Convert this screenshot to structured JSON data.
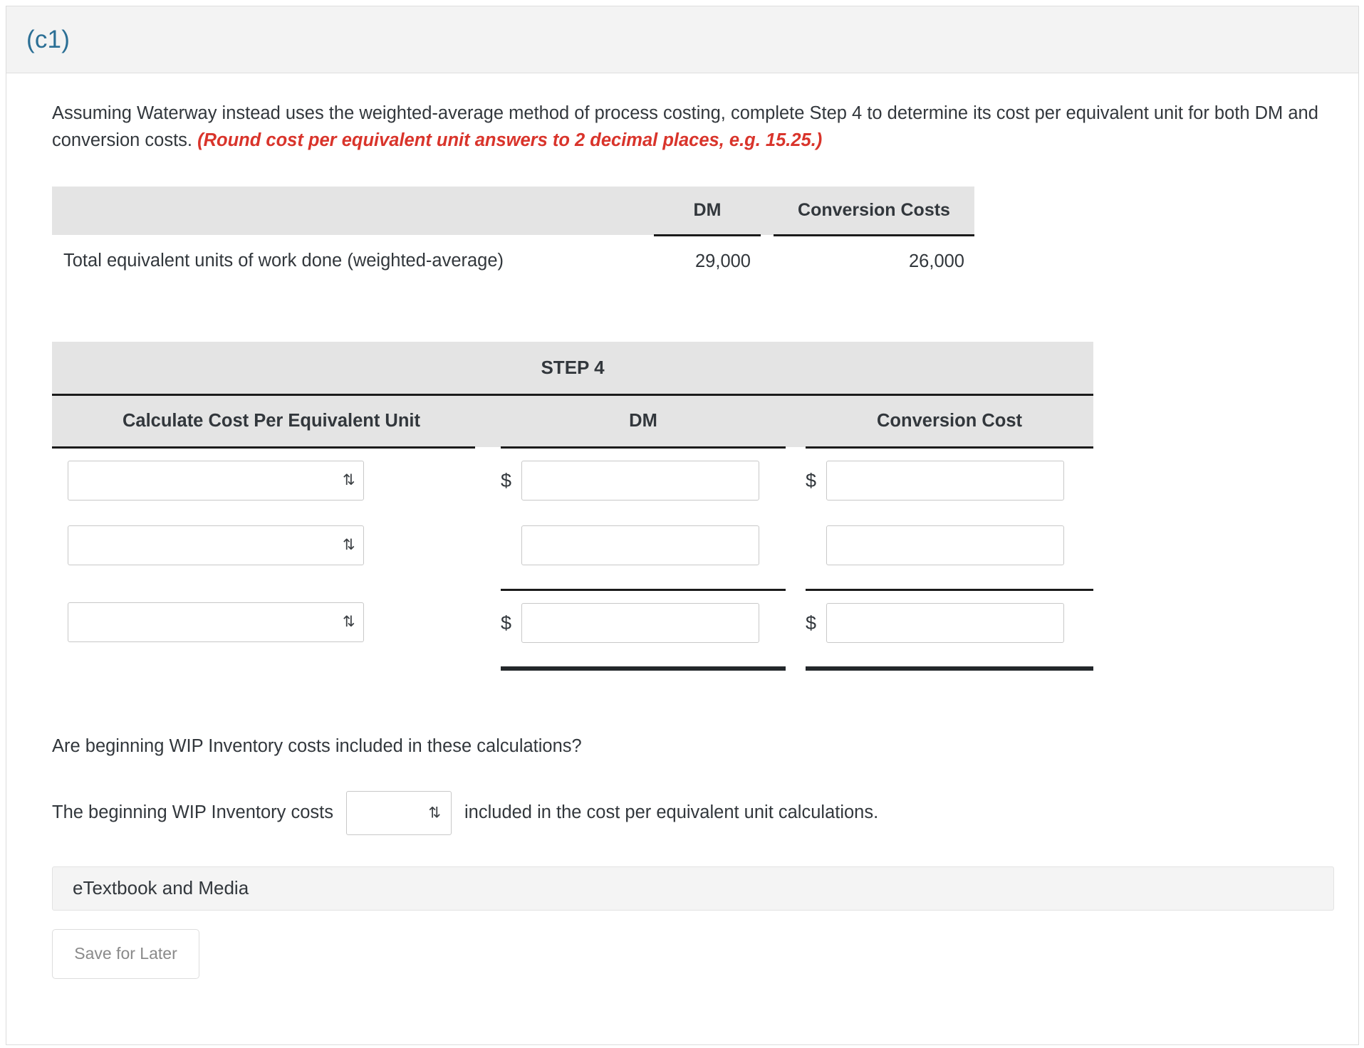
{
  "part": {
    "label": "(c1)"
  },
  "question": {
    "text_before": "Assuming Waterway instead uses the weighted-average method of process costing, complete Step 4 to determine its cost per equivalent unit for both DM and conversion costs.",
    "hint": "(Round cost per equivalent unit answers to 2 decimal places, e.g. 15.25.)"
  },
  "equivalent_units_table": {
    "headers": {
      "blank": "",
      "dm": "DM",
      "conversion": "Conversion Costs"
    },
    "rows": [
      {
        "label": "Total equivalent units of work done (weighted-average)",
        "dm": "29,000",
        "conversion": "26,000"
      }
    ]
  },
  "step_table": {
    "title": "STEP 4",
    "headers": {
      "label": "Calculate Cost Per Equivalent Unit",
      "dm": "DM",
      "conversion": "Conversion Cost"
    },
    "rows": [
      {
        "select_value": "",
        "dm_prefix": "$",
        "dm_value": "",
        "cc_prefix": "$",
        "cc_value": ""
      },
      {
        "select_value": "",
        "dm_prefix": "",
        "dm_value": "",
        "cc_prefix": "",
        "cc_value": ""
      },
      {
        "select_value": "",
        "dm_prefix": "$",
        "dm_value": "",
        "cc_prefix": "$",
        "cc_value": ""
      }
    ],
    "select_chevron": "⇅"
  },
  "wip": {
    "question": "Are beginning WIP Inventory costs included in these calculations?",
    "sentence_before": "The beginning WIP Inventory costs",
    "select_value": "",
    "sentence_after": "included in the cost per equivalent unit calculations.",
    "select_chevron": "⇅"
  },
  "footer": {
    "etextbook_label": "eTextbook and Media",
    "save_label": "Save for Later"
  },
  "colors": {
    "part_label": "#2b6f95",
    "hint_red": "#d9342b",
    "header_bg": "#f3f3f3",
    "table_header_bg": "#e4e4e4",
    "rule": "#1b1b1b"
  }
}
